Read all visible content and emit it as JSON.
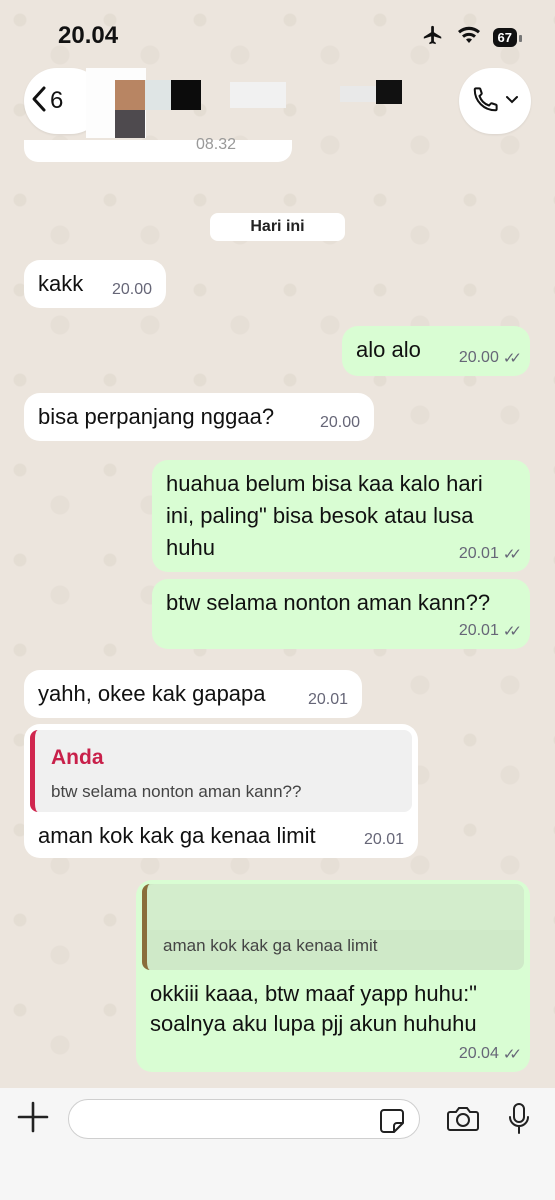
{
  "status": {
    "time": "20.04",
    "battery": "67"
  },
  "header": {
    "back_count": "6"
  },
  "date_chip": "Hari ini",
  "messages": [
    {
      "text": "kakk",
      "time": "20.00"
    },
    {
      "text": "alo alo",
      "time": "20.00"
    },
    {
      "text": "bisa perpanjang nggaa?",
      "time": "20.00"
    },
    {
      "line1": "huahua belum bisa kaa kalo hari",
      "line2": "ini, paling\" bisa besok atau lusa",
      "line3": "huhu",
      "time": "20.01"
    },
    {
      "text": "btw selama nonton aman kann??",
      "time": "20.01"
    },
    {
      "text": "yahh, okee kak gapapa",
      "time": "20.01"
    },
    {
      "quote_name": "Anda",
      "quote_text": "btw selama nonton aman kann??",
      "text": "aman kok kak ga kenaa limit",
      "time": "20.01"
    },
    {
      "quote_text": "aman kok kak ga kenaa limit",
      "line1": "okkiii kaaa, btw maaf yapp huhu:\"",
      "line2": "soalnya aku lupa pjj akun huhuhu",
      "time": "20.04"
    }
  ],
  "colors": {
    "incoming": "#ffffff",
    "outgoing": "#d9fdd3",
    "quote_accent": "#d0264e"
  },
  "icons": [
    "airplane-icon",
    "wifi-icon",
    "back-chevron-icon",
    "phone-icon",
    "plus-icon",
    "sticker-icon",
    "camera-icon",
    "mic-icon"
  ]
}
